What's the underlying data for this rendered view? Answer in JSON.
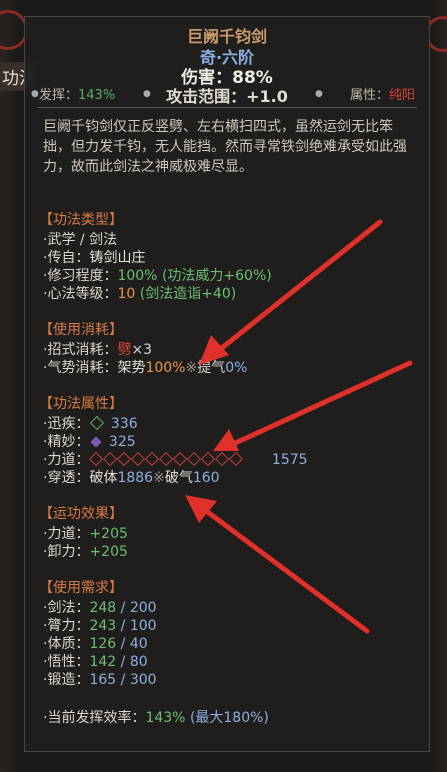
{
  "background": {
    "tab_label": "功法"
  },
  "item": {
    "name": "巨阙千钧剑",
    "rarity": "奇·六阶",
    "damage": "伤害：88%",
    "attack_range": "攻击范围：+1.0",
    "play_label": "发挥：",
    "play_value": "143%",
    "attribute_label": "属性：",
    "attribute_value": "纯阳",
    "description": "巨阙千钧剑仅正反竖劈、左右横扫四式，虽然运剑无比笨拙，但力发千钧，无人能挡。然而寻常铁剑绝难承受如此强力，故而此剑法之神威极难尽显。"
  },
  "type_section": {
    "header": "【功法类型】",
    "category": "武学 / 剑法",
    "source_label": "传自：",
    "source": "铸剑山庄",
    "practice_label": "修习程度：",
    "practice_value": "100%",
    "practice_bonus": "(功法威力+60%)",
    "mind_label": "心法等级：",
    "mind_value": "10",
    "mind_bonus": "(剑法造诣+40)"
  },
  "cost_section": {
    "header": "【使用消耗】",
    "move_label": "招式消耗：",
    "move_glyph": "劈",
    "move_count": "×3",
    "qi_label": "气势消耗：",
    "qi_stance": "架势",
    "qi_stance_value": "100%",
    "qi_sep": "※",
    "qi_breath": "提气",
    "qi_breath_value": "0%"
  },
  "attr_section": {
    "header": "【功法属性】",
    "speed_label": "迅疾：",
    "speed_value": "336",
    "finesse_label": "精妙：",
    "finesse_value": "325",
    "power_label": "力道：",
    "power_value": "1575",
    "pierce_label": "穿透：",
    "pierce_body": "破体",
    "pierce_body_value": "1886",
    "pierce_sep": "※",
    "pierce_qi": "破气",
    "pierce_qi_value": "160"
  },
  "effect_section": {
    "header": "【运功效果】",
    "strength_label": "力道：",
    "strength_value": "+205",
    "deflect_label": "卸力：",
    "deflect_value": "+205"
  },
  "req_section": {
    "header": "【使用需求】",
    "rows": [
      {
        "label": "剑法：",
        "have": "248",
        "need": "200"
      },
      {
        "label": "膂力：",
        "have": "243",
        "need": "100"
      },
      {
        "label": "体质：",
        "have": "126",
        "need": "40"
      },
      {
        "label": "悟性：",
        "have": "142",
        "need": "80"
      },
      {
        "label": "锻造：",
        "have": "165",
        "need": "300"
      }
    ],
    "efficiency_label": "当前发挥效率：",
    "efficiency_value": "143%",
    "efficiency_max": "(最大180%)"
  },
  "colors": {
    "accent_orange": "#d97a45",
    "title": "#c9996a",
    "rarity_blue": "#8ab4e8",
    "good_green": "#6bbf73",
    "arrow_red": "#e0302a"
  }
}
